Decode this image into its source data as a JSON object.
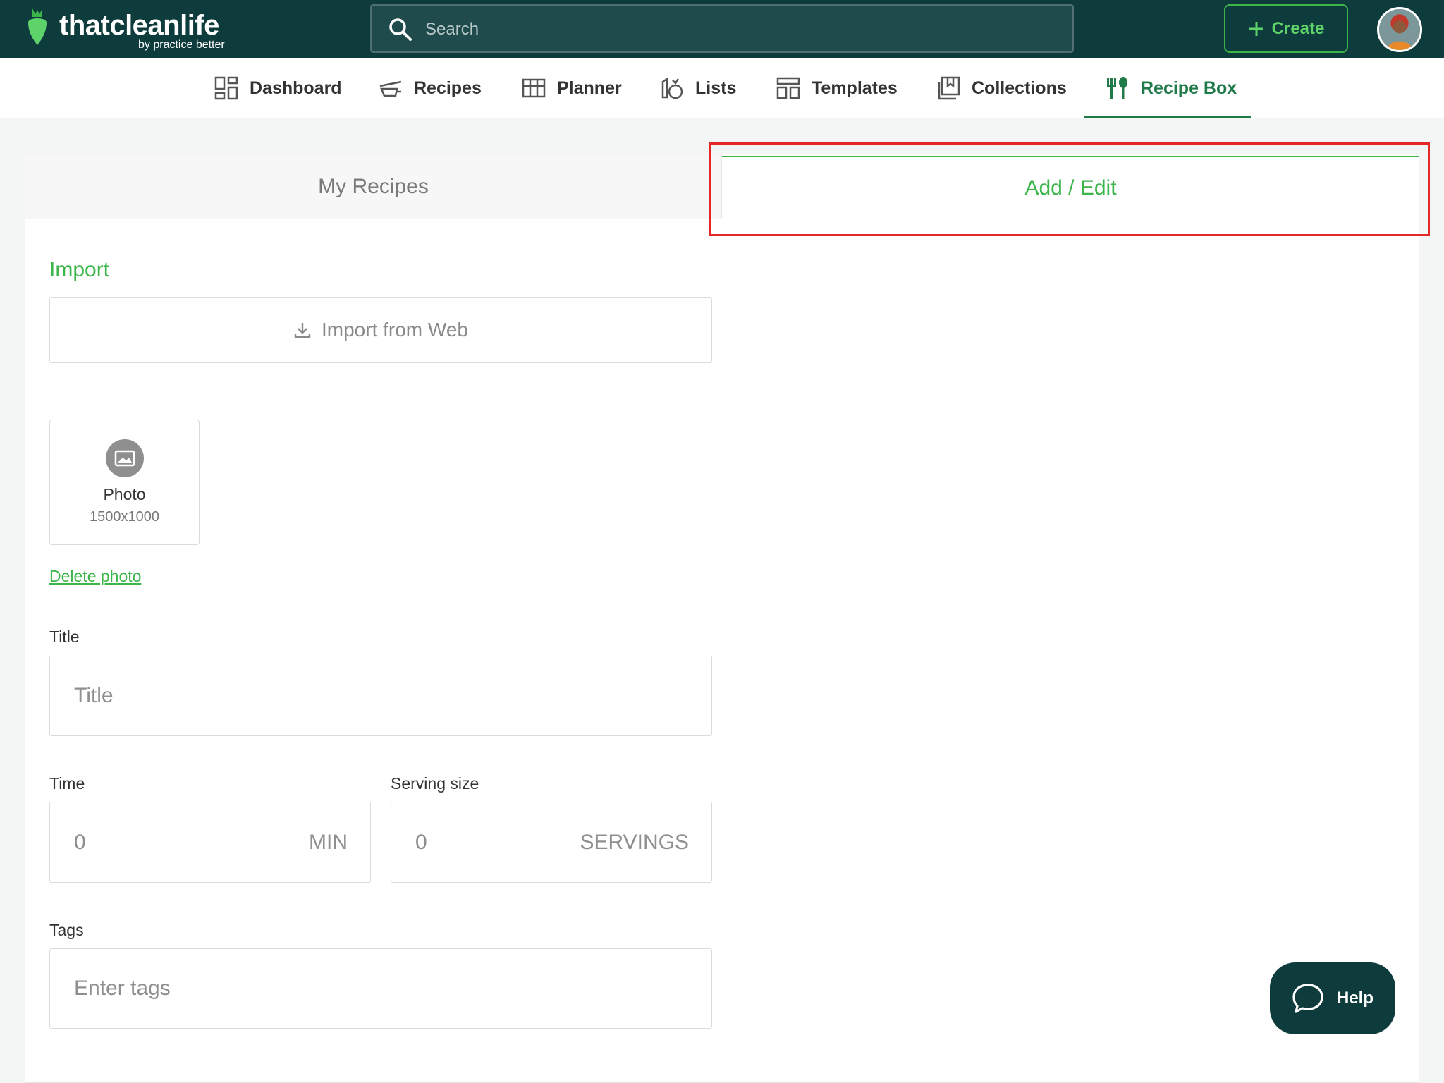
{
  "brand": {
    "name": "thatcleanlife",
    "tagline": "by practice better",
    "logo_icon": "radish-icon",
    "accent_green": "#3cb54a",
    "dark_teal": "#0e3b3c"
  },
  "header": {
    "search_placeholder": "Search",
    "create_label": "Create"
  },
  "nav": {
    "items": [
      {
        "label": "Dashboard",
        "icon": "dashboard-icon"
      },
      {
        "label": "Recipes",
        "icon": "recipes-icon"
      },
      {
        "label": "Planner",
        "icon": "planner-icon"
      },
      {
        "label": "Lists",
        "icon": "lists-icon"
      },
      {
        "label": "Templates",
        "icon": "templates-icon"
      },
      {
        "label": "Collections",
        "icon": "collections-icon"
      },
      {
        "label": "Recipe Box",
        "icon": "fork-spoon-icon",
        "active": true
      }
    ]
  },
  "tabs": {
    "my_recipes": "My Recipes",
    "add_edit": "Add / Edit"
  },
  "form": {
    "import_title": "Import",
    "import_button": "Import from Web",
    "photo_label": "Photo",
    "photo_dimensions": "1500x1000",
    "delete_photo": "Delete photo",
    "title_label": "Title",
    "title_placeholder": "Title",
    "time_label": "Time",
    "time_value": "0",
    "time_unit": "MIN",
    "serving_label": "Serving size",
    "serving_value": "0",
    "serving_unit": "SERVINGS",
    "tags_label": "Tags",
    "tags_placeholder": "Enter tags"
  },
  "help": {
    "label": "Help"
  }
}
